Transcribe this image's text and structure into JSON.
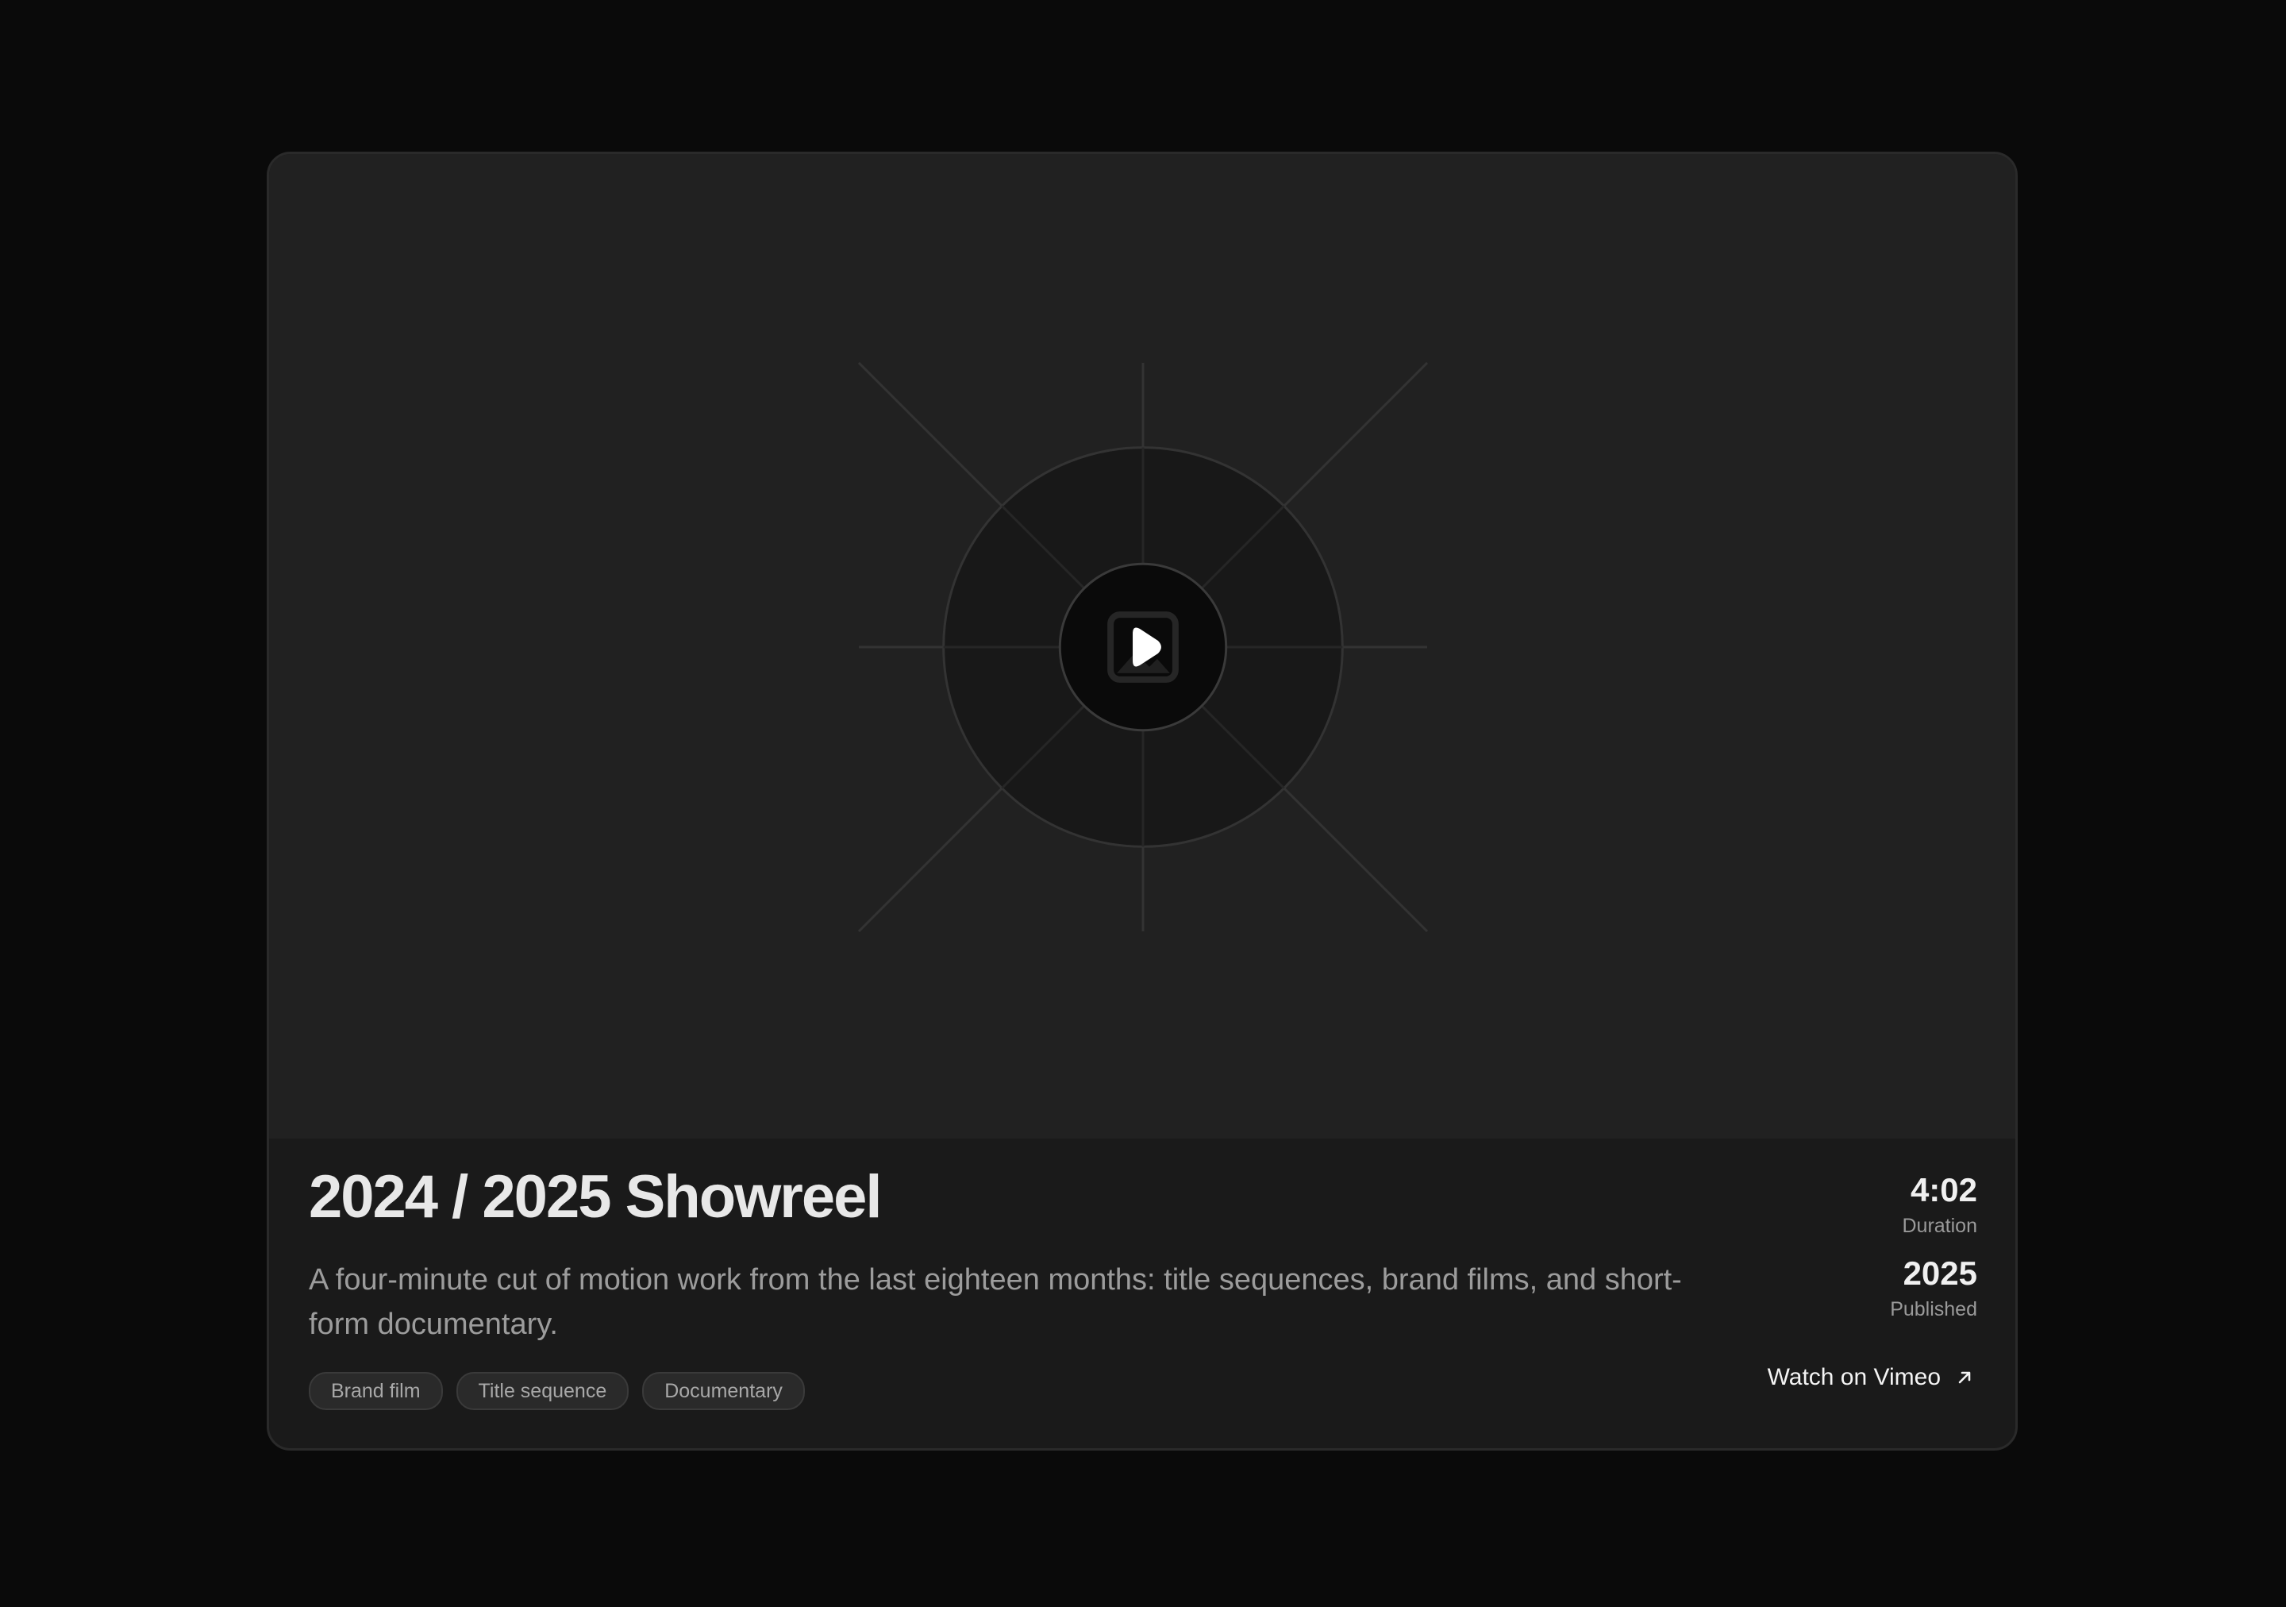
{
  "video": {
    "title": "2024 / 2025 Showreel",
    "description": "A four-minute cut of motion work from the last eighteen months: title sequences, brand films, and short-form documentary.",
    "tags": [
      "Brand film",
      "Title sequence",
      "Documentary"
    ],
    "duration": {
      "value": "4:02",
      "label": "Duration"
    },
    "published": {
      "value": "2025",
      "label": "Published"
    },
    "link_label": "Watch on Vimeo"
  },
  "icons": {
    "play": "play-icon",
    "placeholder": "image-placeholder-icon",
    "external": "arrow-up-right-icon"
  },
  "colors": {
    "page_background": "#0a0a0a",
    "card_background": "#1a1a1a",
    "media_background": "#212121",
    "title": "#e8e8e8",
    "accent_text": "#ffffff"
  }
}
